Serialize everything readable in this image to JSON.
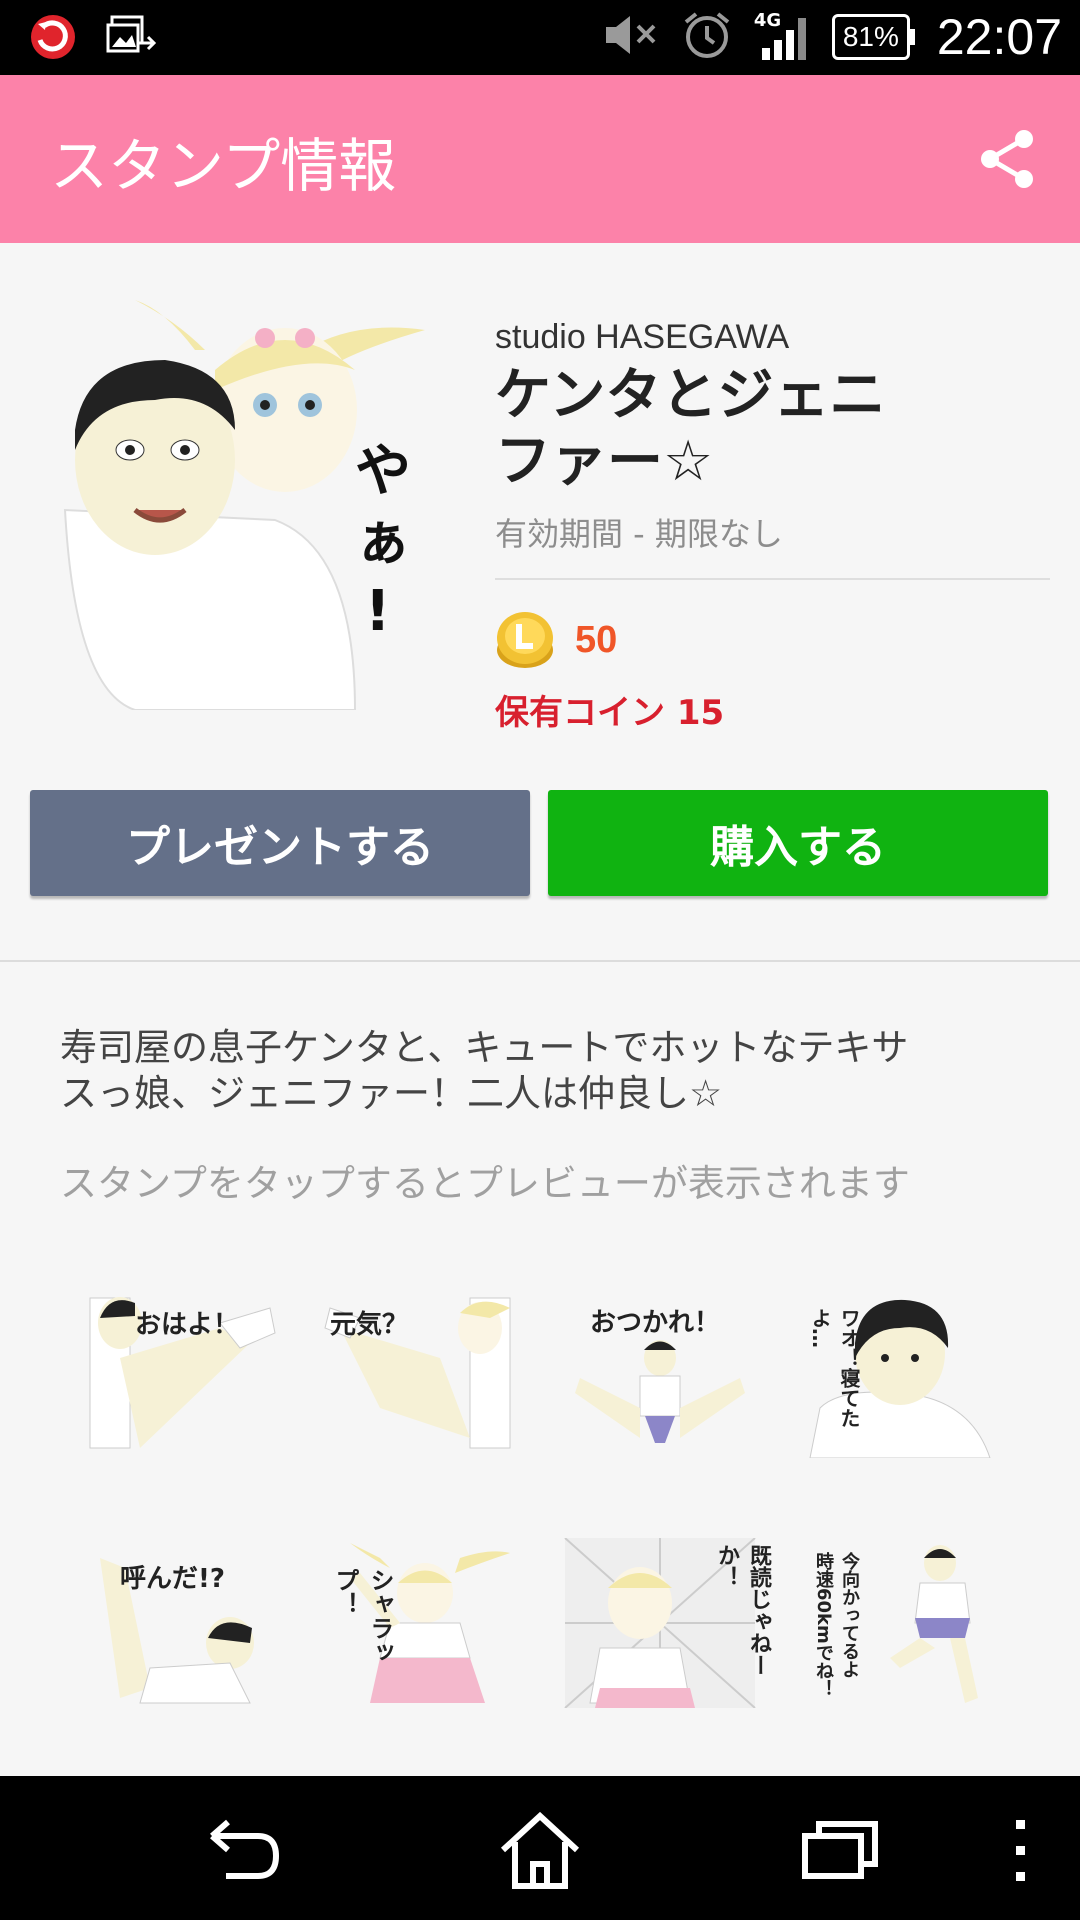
{
  "status_bar": {
    "time": "22:07",
    "battery": "81%",
    "network": "4G",
    "icons": [
      "trend-micro-icon",
      "gallery-sync-icon",
      "mute-icon",
      "alarm-icon",
      "signal-icon",
      "battery-icon"
    ]
  },
  "header": {
    "title": "スタンプ情報",
    "share_icon": "share-icon",
    "color": "#fc82a9"
  },
  "sticker": {
    "author": "studio HASEGAWA",
    "title_line1": "ケンタとジェニ",
    "title_line2": "ファー☆",
    "validity": "有効期間 - 期限なし",
    "price": "50",
    "owned_coins": "保有コイン 15"
  },
  "buttons": {
    "gift": "プレゼントする",
    "buy": "購入する",
    "gift_color": "#647089",
    "buy_color": "#10b311"
  },
  "description": {
    "line1": "寿司屋の息子ケンタと、キュートでホットなテキサ",
    "line2": "スっ娘、ジェニファー！二人は仲良し☆",
    "hint": "スタンプをタップするとプレビューが表示されます"
  },
  "stickers": [
    {
      "caption": "おはよ！"
    },
    {
      "caption": "元気？"
    },
    {
      "caption": "おつかれ！"
    },
    {
      "caption": "ワオ！寝てたよ…"
    },
    {
      "caption": "呼んだ!?"
    },
    {
      "caption": "シャラップ！"
    },
    {
      "caption": "既読じゃねーか！"
    },
    {
      "caption": "今向かってるよ 時速60kmでね！"
    }
  ],
  "nav": {
    "icons": [
      "back-icon",
      "home-icon",
      "recents-icon",
      "menu-icon"
    ]
  }
}
